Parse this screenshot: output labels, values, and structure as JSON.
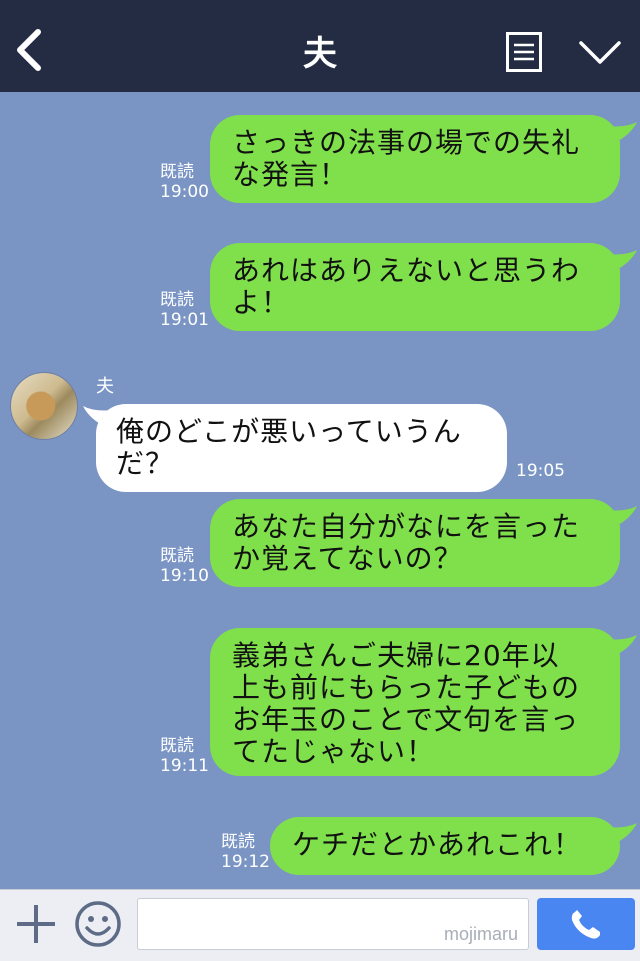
{
  "header": {
    "title": "夫",
    "back_icon": "chevron-left-icon",
    "menu_icon": "menu-list-icon",
    "expand_icon": "chevron-down-icon"
  },
  "colors": {
    "header_bg": "#232c43",
    "chat_bg": "#7a95c4",
    "outgoing_bubble": "#80e04b",
    "incoming_bubble": "#ffffff",
    "call_button": "#4a86f2"
  },
  "messages": [
    {
      "direction": "out",
      "text": "さっきの法事の場での失礼\nな発言！",
      "read": "既読",
      "time": "19:00"
    },
    {
      "direction": "out",
      "text": "あれはありえないと思うわ\nよ！",
      "read": "既読",
      "time": "19:01"
    },
    {
      "direction": "in",
      "sender": "夫",
      "text": "俺のどこが悪いっていうん\nだ？",
      "time": "19:05"
    },
    {
      "direction": "out",
      "text": "あなた自分がなにを言った\nか覚えてないの？",
      "read": "既読",
      "time": "19:10"
    },
    {
      "direction": "out",
      "text": "義弟さんご夫婦に20年以\n上も前にもらった子どもの\nお年玉のことで文句を言っ\nてたじゃない！",
      "read": "既読",
      "time": "19:11"
    },
    {
      "direction": "out",
      "text": "ケチだとかあれこれ！",
      "read": "既読",
      "time": "19:12"
    }
  ],
  "input": {
    "placeholder": "",
    "watermark": "mojimaru",
    "plus_icon": "plus-icon",
    "emoji_icon": "smiley-icon",
    "call_icon": "phone-icon"
  }
}
